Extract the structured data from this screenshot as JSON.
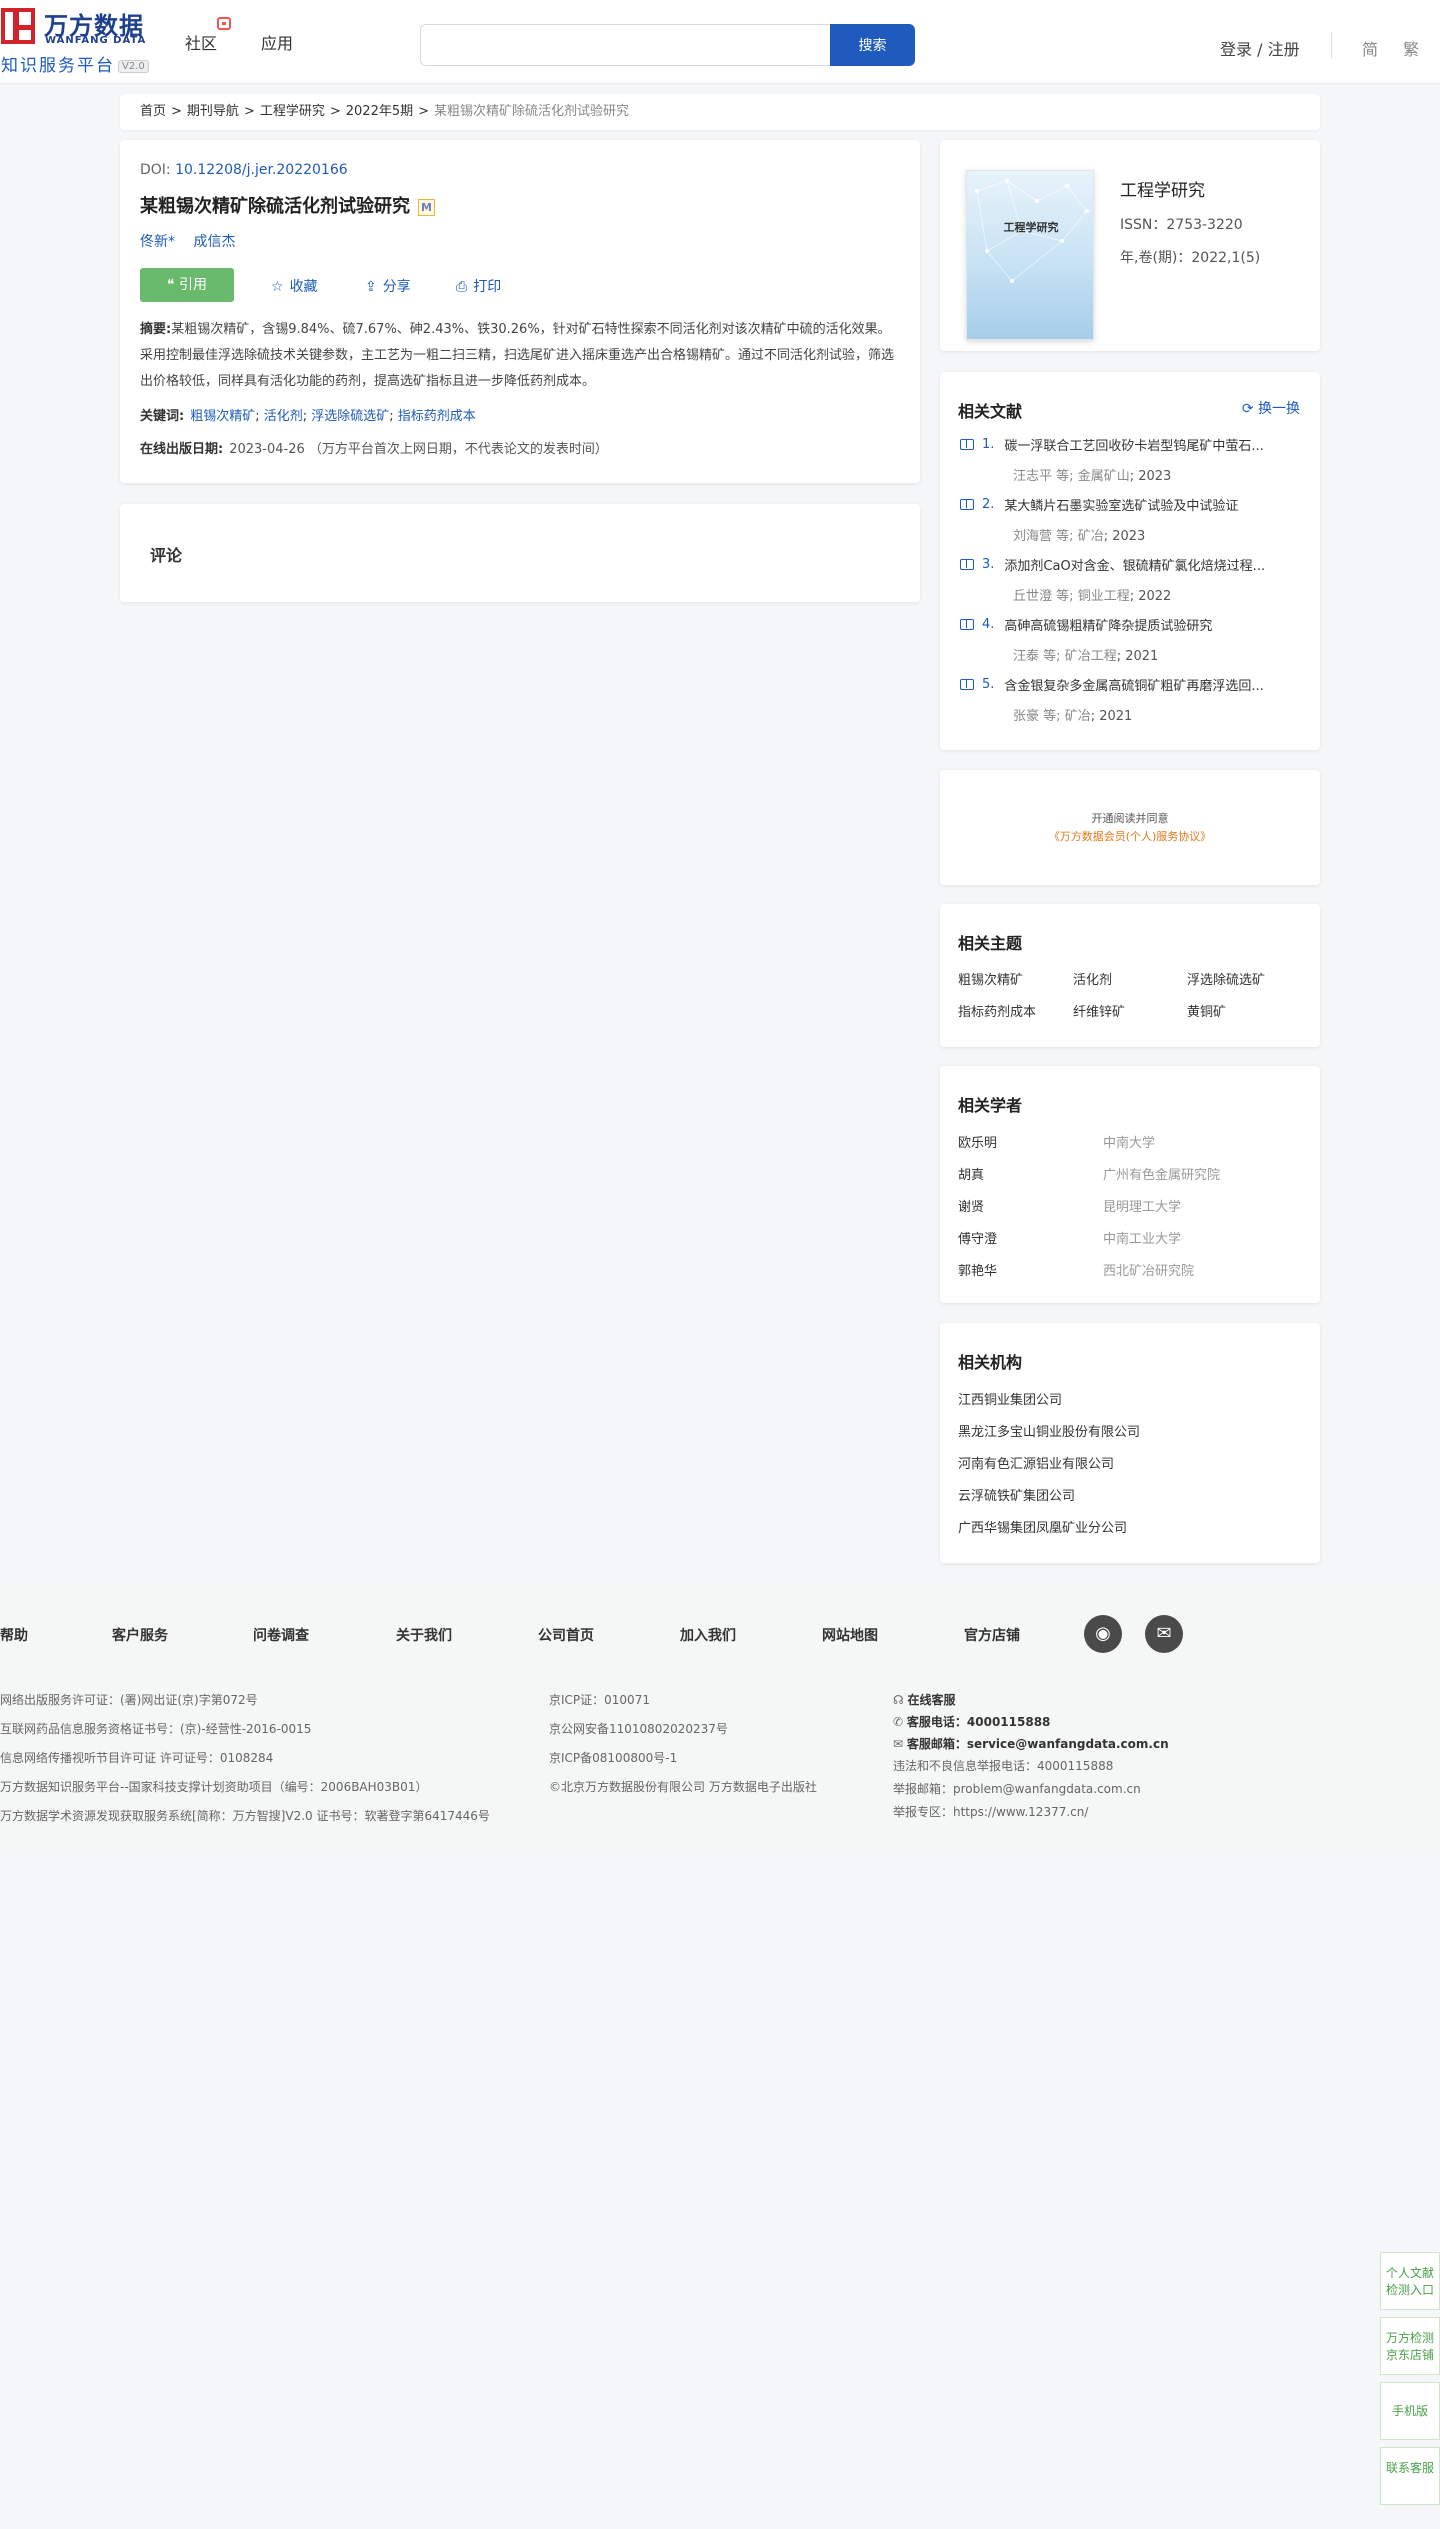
{
  "header": {
    "logo_cn": "万方数据",
    "logo_en": "WANFANG DATA",
    "logo_sub": "知识服务平台",
    "logo_version": "V2.0",
    "nav": [
      "社区",
      "应用"
    ],
    "search_placeholder": "",
    "search_button": "搜索",
    "login": "登录 / 注册",
    "lang_simplified": "简",
    "lang_traditional": "繁"
  },
  "breadcrumb": [
    "首页",
    "期刊导航",
    "工程学研究",
    "2022年5期",
    "某粗锡次精矿除硫活化剂试验研究"
  ],
  "article": {
    "doi_label": "DOI:",
    "doi": "10.12208/j.jer.20220166",
    "title": "某粗锡次精矿除硫活化剂试验研究",
    "badge": "M",
    "authors": [
      "佟新*",
      "成信杰"
    ],
    "actions": {
      "cite": "引用",
      "favorite": "收藏",
      "share": "分享",
      "print": "打印"
    },
    "abstract_label": "摘要:",
    "abstract": "某粗锡次精矿，含锡9.84%、硫7.67%、砷2.43%、铁30.26%，针对矿石特性探索不同活化剂对该次精矿中硫的活化效果。采用控制最佳浮选除硫技术关键参数，主工艺为一粗二扫三精，扫选尾矿进入摇床重选产出合格锡精矿。通过不同活化剂试验，筛选出价格较低，同样具有活化功能的药剂，提高选矿指标且进一步降低药剂成本。",
    "keywords_label": "关键词:",
    "keywords": [
      "粗锡次精矿",
      "活化剂",
      "浮选除硫选矿",
      "指标药剂成本"
    ],
    "pubdate_label": "在线出版日期:",
    "pubdate": "2023-04-26",
    "pubdate_note": "（万方平台首次上网日期，不代表论文的发表时间）"
  },
  "comment": {
    "title": "评论"
  },
  "journal": {
    "cover_title": "工程学研究",
    "name": "工程学研究",
    "issn": "ISSN：2753-3220",
    "volume": "年,卷(期)：2022,1(5)"
  },
  "related_docs": {
    "title": "相关文献",
    "refresh": "换一换",
    "items": [
      {
        "num": "1.",
        "title": "碳一浮联合工艺回收矽卡岩型钨尾矿中萤石...",
        "author": "汪志平",
        "etal": "等;",
        "source": "金属矿山",
        "year": "; 2023"
      },
      {
        "num": "2.",
        "title": "某大鳞片石墨实验室选矿试验及中试验证",
        "author": "刘海营",
        "etal": "等;",
        "source": "矿冶",
        "year": "; 2023"
      },
      {
        "num": "3.",
        "title": "添加剂CaO对含金、银硫精矿氯化焙烧过程...",
        "author": "丘世澄",
        "etal": "等;",
        "source": "铜业工程",
        "year": "; 2022"
      },
      {
        "num": "4.",
        "title": "高砷高硫锡粗精矿降杂提质试验研究",
        "author": "汪泰",
        "etal": "等;",
        "source": "矿冶工程",
        "year": "; 2021"
      },
      {
        "num": "5.",
        "title": "含金银复杂多金属高硫铜矿粗矿再磨浮选回...",
        "author": "张豪",
        "etal": "等;",
        "source": "矿冶",
        "year": "; 2021"
      }
    ]
  },
  "notice": {
    "line1": "开通阅读并同意",
    "line2": "《万方数据会员(个人)服务协议》"
  },
  "topics": {
    "title": "相关主题",
    "items": [
      "粗锡次精矿",
      "活化剂",
      "浮选除硫选矿",
      "指标药剂成本",
      "纤维锌矿",
      "黄铜矿"
    ]
  },
  "scholars": {
    "title": "相关学者",
    "items": [
      {
        "name": "欧乐明",
        "org": "中南大学"
      },
      {
        "name": "胡真",
        "org": "广州有色金属研究院"
      },
      {
        "name": "谢贤",
        "org": "昆明理工大学"
      },
      {
        "name": "傅守澄",
        "org": "中南工业大学"
      },
      {
        "name": "郭艳华",
        "org": "西北矿冶研究院"
      }
    ]
  },
  "institutions": {
    "title": "相关机构",
    "items": [
      "江西铜业集团公司",
      "黑龙江多宝山铜业股份有限公司",
      "河南有色汇源铝业有限公司",
      "云浮硫铁矿集团公司",
      "广西华锡集团凤凰矿业分公司"
    ]
  },
  "footer": {
    "links": [
      "帮助",
      "客户服务",
      "问卷调查",
      "关于我们",
      "公司首页",
      "加入我们",
      "网站地图",
      "官方店铺"
    ],
    "col1": [
      "网络出版服务许可证：(署)网出证(京)字第072号",
      "互联网药品信息服务资格证书号：(京)-经营性-2016-0015",
      "信息网络传播视听节目许可证 许可证号：0108284",
      "万方数据知识服务平台--国家科技支撑计划资助项目（编号：2006BAH03B01）",
      "万方数据学术资源发现获取服务系统[简称：万方智搜]V2.0 证书号：软著登字第6417446号"
    ],
    "col2": [
      "京ICP证：010071",
      "京公网安备11010802020237号",
      "京ICP备08100800号-1",
      "©北京万方数据股份有限公司 万方数据电子出版社"
    ],
    "col3": {
      "online": "在线客服",
      "phone_label": "客服电话：",
      "phone": "4000115888",
      "mail_label": "客服邮箱：",
      "mail": "service@wanfangdata.com.cn",
      "report_phone": "违法和不良信息举报电话：4000115888",
      "report_mail": "举报邮箱：problem@wanfangdata.com.cn",
      "report_site": "举报专区：https://www.12377.cn/"
    }
  },
  "float_tabs": [
    "个人文献检测入口",
    "万方检测京东店铺",
    "手机版",
    "联系客服"
  ]
}
